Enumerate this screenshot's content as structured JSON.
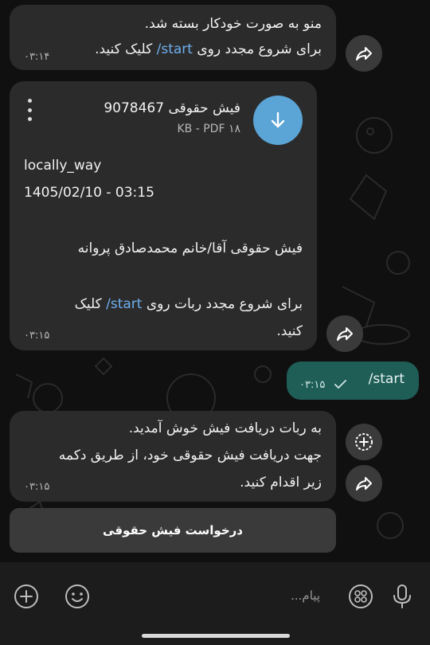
{
  "messages": {
    "m1": {
      "line1": "منو به صورت خودکار بسته شد.",
      "line2_prefix": "برای شروع مجدد روی ",
      "line2_link": "/start",
      "line2_suffix": " کلیک کنید.",
      "time": "۰۳:۱۴"
    },
    "m2": {
      "file_name": "فیش حقوقی 9078467",
      "file_meta": "۱۸ KB - PDF",
      "username": "locally_way",
      "datetime": "1405/02/10 - 03:15",
      "caption": "فیش حقوقی آقا/خانم محمدصادق پروانه",
      "restart_prefix": "برای شروع مجدد ربات روی ",
      "restart_link": "/start",
      "restart_suffix": " کلیک",
      "restart_line2": "کنید.",
      "time": "۰۳:۱۵"
    },
    "m3": {
      "text": "/start",
      "time": "۰۳:۱۵"
    },
    "m4": {
      "line1": "به ربات دریافت فیش خوش آمدید.",
      "line2": "جهت دریافت فیش حقوقی خود، از طریق دکمه",
      "line3": "زیر اقدام کنید.",
      "time": "۰۳:۱۵"
    }
  },
  "inline_button": {
    "label": "درخواست فیش حقوقی"
  },
  "input": {
    "placeholder": "پیام..."
  },
  "icons": {
    "forward": "forward-icon",
    "download": "download-arrow-icon",
    "menu": "kebab-menu-icon",
    "check": "single-check-icon",
    "add_reaction": "add-circle-icon",
    "attach": "plus-circle-icon",
    "emoji": "smiley-icon",
    "apps": "grid-icon",
    "mic": "microphone-icon"
  },
  "colors": {
    "incoming_bubble": "#2b2b2b",
    "outgoing_bubble": "#1f5d57",
    "link": "#6fb0f0",
    "file_icon": "#5aa4d6",
    "background": "#101010"
  }
}
